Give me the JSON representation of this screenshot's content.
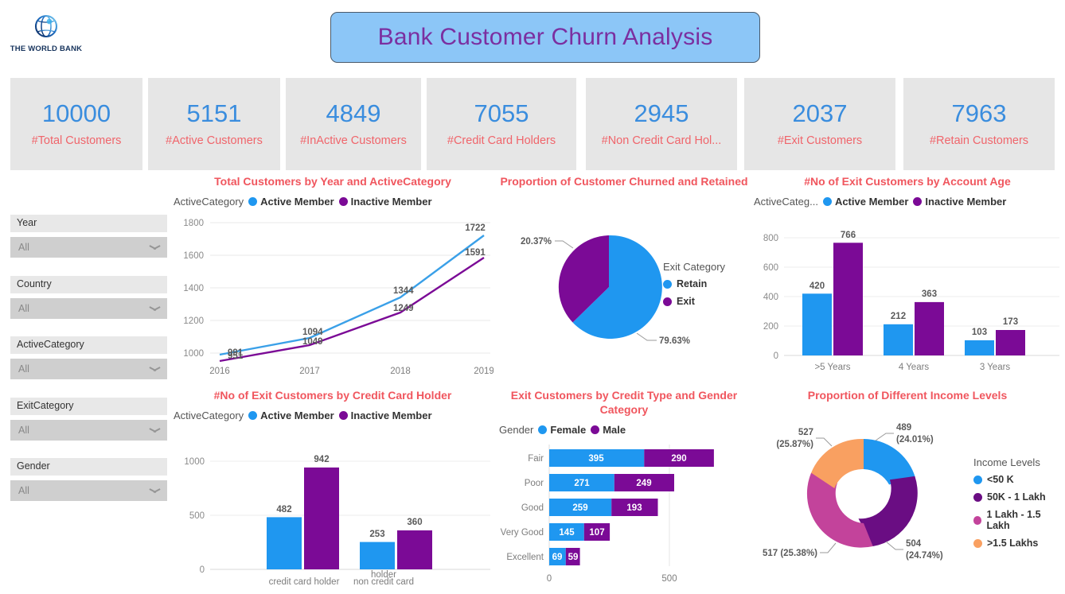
{
  "header": {
    "logo_name": "world-bank-logo",
    "logo_text": "THE WORLD BANK",
    "title": "Bank Customer Churn Analysis"
  },
  "colors": {
    "blue": "#1f97f0",
    "purple": "#7b0a96",
    "magenta": "#c3439b",
    "orange": "#f9a061",
    "kpi_value": "#3a8dde",
    "kpi_label": "#f0656b",
    "panel_title": "#f0565e",
    "banner_bg": "#8cc6f7",
    "banner_text": "#7b2fa0",
    "card_bg": "#e6e6e6"
  },
  "kpis": [
    {
      "value": "10000",
      "label": "#Total Customers"
    },
    {
      "value": "5151",
      "label": "#Active Customers"
    },
    {
      "value": "4849",
      "label": "#InActive Customers"
    },
    {
      "value": "7055",
      "label": "#Credit Card Holders"
    },
    {
      "value": "2945",
      "label": "#Non Credit Card Hol..."
    },
    {
      "value": "2037",
      "label": "#Exit Customers"
    },
    {
      "value": "7963",
      "label": "#Retain Customers"
    }
  ],
  "slicers": [
    {
      "field": "Year",
      "value": "All"
    },
    {
      "field": "Country",
      "value": "All"
    },
    {
      "field": "ActiveCategory",
      "value": "All"
    },
    {
      "field": "ExitCategory",
      "value": "All"
    },
    {
      "field": "Gender",
      "value": "All"
    }
  ],
  "chart_data": [
    {
      "id": "line_total_customers",
      "type": "line",
      "title": "Total Customers by Year and ActiveCategory",
      "legend_caption": "ActiveCategory",
      "legend_position": "top",
      "x": [
        "2016",
        "2017",
        "2018",
        "2019"
      ],
      "xlabel": "",
      "ylabel": "",
      "ylim": [
        950,
        1800
      ],
      "yticks": [
        1000,
        1200,
        1400,
        1600,
        1800
      ],
      "grid": true,
      "series": [
        {
          "name": "Active Member",
          "color": "#3aa0e8",
          "values": [
            991,
            1094,
            1344,
            1722
          ]
        },
        {
          "name": "Inactive Member",
          "color": "#7b0a96",
          "values": [
            951,
            1049,
            1249,
            1591
          ]
        }
      ]
    },
    {
      "id": "pie_churn_retain",
      "type": "pie",
      "title": "Proportion of Customer Churned and Retained",
      "legend_title": "Exit Category",
      "legend_position": "right",
      "labels": [
        "Retain",
        "Exit"
      ],
      "percents": [
        "79.63%",
        "20.37%"
      ],
      "values": [
        79.63,
        20.37
      ],
      "colors": [
        "#1f97f0",
        "#7b0a96"
      ]
    },
    {
      "id": "bar_exit_by_account_age",
      "type": "bar",
      "title": "#No of Exit Customers by Account Age",
      "legend_caption": "ActiveCateg...",
      "legend_position": "top",
      "categories": [
        ">5 Years",
        "4 Years",
        "3 Years"
      ],
      "xlabel": "",
      "ylabel": "",
      "ylim": [
        0,
        860
      ],
      "yticks": [
        0,
        200,
        400,
        600,
        800
      ],
      "grid": true,
      "series": [
        {
          "name": "Active Member",
          "color": "#1f97f0",
          "values": [
            420,
            212,
            103
          ]
        },
        {
          "name": "Inactive Member",
          "color": "#7b0a96",
          "values": [
            766,
            363,
            173
          ]
        }
      ]
    },
    {
      "id": "bar_exit_by_credit_card_holder",
      "type": "bar",
      "title": "#No of Exit Customers by Credit Card Holder",
      "legend_caption": "ActiveCategory",
      "legend_position": "top",
      "categories": [
        "credit card holder",
        "non credit card holder"
      ],
      "xlabel": "",
      "ylabel": "",
      "ylim": [
        0,
        1080
      ],
      "yticks": [
        0,
        500,
        1000
      ],
      "grid": true,
      "series": [
        {
          "name": "Active Member",
          "color": "#1f97f0",
          "values": [
            482,
            253
          ]
        },
        {
          "name": "Inactive Member",
          "color": "#7b0a96",
          "values": [
            942,
            360
          ]
        }
      ]
    },
    {
      "id": "stackedbar_credit_type_gender",
      "type": "bar",
      "orientation": "horizontal",
      "stacked": true,
      "title": "Exit Customers by Credit Type and Gender Category",
      "legend_caption": "Gender",
      "legend_position": "top",
      "categories": [
        "Fair",
        "Poor",
        "Good",
        "Very Good",
        "Excellent"
      ],
      "xlabel": "",
      "ylabel": "",
      "xlim": [
        0,
        760
      ],
      "xticks": [
        0,
        500
      ],
      "grid": true,
      "series": [
        {
          "name": "Female",
          "color": "#1f97f0",
          "values": [
            395,
            271,
            259,
            145,
            69
          ]
        },
        {
          "name": "Male",
          "color": "#7b0a96",
          "values": [
            290,
            249,
            193,
            107,
            59
          ]
        }
      ]
    },
    {
      "id": "donut_income_levels",
      "type": "pie",
      "variant": "donut",
      "title": "Proportion of Different Income Levels",
      "legend_title": "Income Levels",
      "legend_position": "right",
      "labels": [
        "<50 K",
        "50K - 1 Lakh",
        "1 Lakh - 1.5 Lakh",
        ">1.5 Lakhs"
      ],
      "values": [
        489,
        504,
        517,
        527
      ],
      "percents": [
        "24.01%",
        "24.74%",
        "25.38%",
        "25.87%"
      ],
      "data_labels": [
        "489\n(24.01%)",
        "504\n(24.74%)",
        "517 (25.38%)",
        "527\n(25.87%)"
      ],
      "colors": [
        "#1f97f0",
        "#6a0d83",
        "#c3439b",
        "#f9a061"
      ]
    }
  ],
  "charts": {
    "line": {
      "title": "Total Customers by Year and ActiveCategory",
      "legend_caption": "ActiveCategory",
      "s1": "Active Member",
      "s2": "Inactive Member",
      "yt": [
        "1800",
        "1600",
        "1400",
        "1200",
        "1000"
      ],
      "xt": [
        "2016",
        "2017",
        "2018",
        "2019"
      ],
      "l_a": [
        "991",
        "1094",
        "1344",
        "1722"
      ],
      "l_i": [
        "951",
        "1049",
        "1249",
        "1591"
      ]
    },
    "pie": {
      "title": "Proportion of Customer Churned and Retained",
      "legend_title": "Exit Category",
      "l1": "Retain",
      "l2": "Exit",
      "p1": "79.63%",
      "p2": "20.37%"
    },
    "age": {
      "title": "#No of Exit Customers by Account Age",
      "legend_caption": "ActiveCateg...",
      "s1": "Active Member",
      "s2": "Inactive Member",
      "yt": [
        "800",
        "600",
        "400",
        "200",
        "0"
      ],
      "cats": [
        ">5 Years",
        "4 Years",
        "3 Years"
      ],
      "a": [
        "420",
        "212",
        "103"
      ],
      "i": [
        "766",
        "363",
        "173"
      ]
    },
    "cch": {
      "title": "#No of Exit Customers by Credit Card Holder",
      "legend_caption": "ActiveCategory",
      "s1": "Active Member",
      "s2": "Inactive Member",
      "yt": [
        "1000",
        "500",
        "0"
      ],
      "cat1a": "credit card holder",
      "cat2a": "non credit card",
      "cat2b": "holder",
      "a": [
        "482",
        "253"
      ],
      "i": [
        "942",
        "360"
      ]
    },
    "stk": {
      "title": "Exit Customers by Credit Type and Gender Category",
      "legend_caption": "Gender",
      "s1": "Female",
      "s2": "Male",
      "cats": [
        "Fair",
        "Poor",
        "Good",
        "Very Good",
        "Excellent"
      ],
      "f": [
        "395",
        "271",
        "259",
        "145",
        "69"
      ],
      "m": [
        "290",
        "249",
        "193",
        "107",
        "59"
      ],
      "xt": [
        "0",
        "500"
      ]
    },
    "donut": {
      "title": "Proportion of Different Income Levels",
      "legend_title": "Income Levels",
      "lg": [
        "<50 K",
        "50K - 1 Lakh",
        "1 Lakh - 1.5 Lakh",
        ">1.5 Lakhs"
      ],
      "v489a": "489",
      "v489b": "(24.01%)",
      "v504a": "504",
      "v504b": "(24.74%)",
      "v517": "517 (25.38%)",
      "v527a": "527",
      "v527b": "(25.87%)"
    }
  }
}
